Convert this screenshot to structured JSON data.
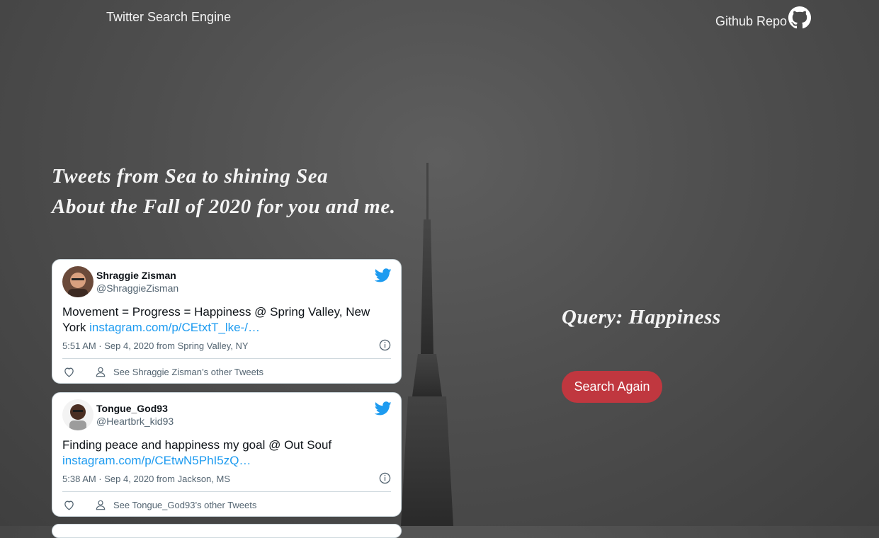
{
  "nav": {
    "title": "Twitter Search Engine",
    "github_label": "Github Repo",
    "github_icon": "github-icon"
  },
  "hero": {
    "line1": "Tweets from Sea to shining Sea",
    "line2": "About the Fall of 2020 for you and me."
  },
  "query": {
    "label": "Query: Happiness",
    "button": "Search Again",
    "button_color": "#c0373f"
  },
  "tweets": [
    {
      "name": "Shraggie Zisman",
      "handle": "@ShraggieZisman",
      "text": "Movement = Progress = Happiness @ Spring Valley, New York ",
      "link": "instagram.com/p/CEtxtT_lke-/…",
      "meta": "5:51 AM · Sep 4, 2020 from Spring Valley, NY",
      "other": "See Shraggie Zisman’s other Tweets"
    },
    {
      "name": "Tongue_God93",
      "handle": "@Heartbrk_kid93",
      "text": "Finding peace and happiness my goal @ Out Souf ",
      "link": "instagram.com/p/CEtwN5PhI5zQ…",
      "meta": "5:38 AM · Sep 4, 2020 from Jackson, MS",
      "other": "See Tongue_God93’s other Tweets"
    }
  ],
  "colors": {
    "twitter_blue": "#1d9bf0",
    "background": "#4f4f4f"
  }
}
